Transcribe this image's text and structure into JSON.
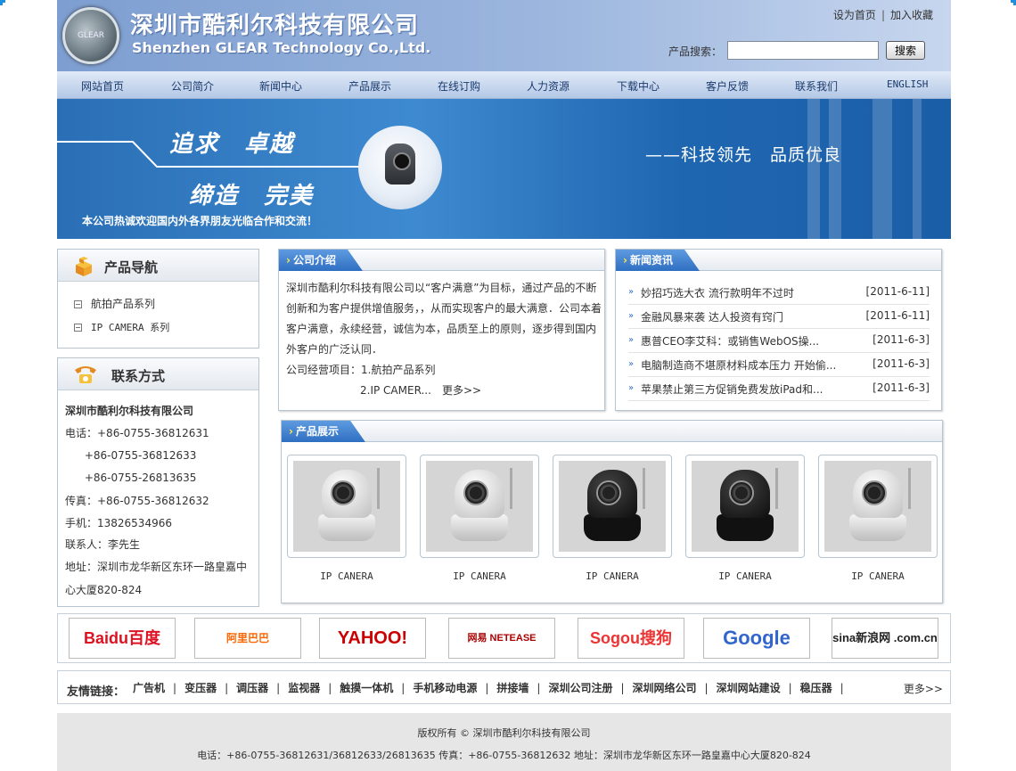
{
  "header": {
    "logo_text": "GLEAR",
    "company_cn": "深圳市酷利尔科技有限公司",
    "company_en": "Shenzhen GLEAR Technology Co.,Ltd.",
    "set_home": "设为首页",
    "separator": "|",
    "add_favorite": "加入收藏",
    "search_label": "产品搜索：",
    "search_value": "",
    "search_button": "搜索"
  },
  "nav": [
    "网站首页",
    "公司简介",
    "新闻中心",
    "产品展示",
    "在线订购",
    "人力资源",
    "下载中心",
    "客户反馈",
    "联系我们",
    "ENGLISH"
  ],
  "banner": {
    "slogan1": "追求　卓越",
    "slogan2": "缔造　完美",
    "slogan3": "——科技领先　品质优良",
    "welcome": "本公司热诚欢迎国内外各界朋友光临合作和交流！"
  },
  "product_nav": {
    "title": "产品导航",
    "items": [
      "航拍产品系列",
      "IP CAMERA 系列"
    ]
  },
  "contact": {
    "title": "联系方式",
    "company": "深圳市酷利尔科技有限公司",
    "lines": [
      "电话：+86-0755-36812631",
      "　 +86-0755-36812633",
      "　 +86-0755-26813635",
      "传真：+86-0755-36812632",
      "手机：13826534966",
      "联系人：李先生",
      "地址：深圳市龙华新区东环一路皇嘉中",
      "心大厦820-824"
    ]
  },
  "about": {
    "title": "公司介绍",
    "text1": "深圳市酷利尔科技有限公司以“客户满意”为目标，通过产品的不断创新和为客户提供增值服务，，从而实现客户的最大满意．公司本着客户满意，永续经营，诚信为本，品质至上的原则，逐步得到国内外客户的广泛认同．",
    "text2": "公司经营项目：1.航拍产品系列",
    "text3": "2.IP CAMER...",
    "more": "更多>>"
  },
  "news": {
    "title": "新闻资讯",
    "items": [
      {
        "title": "妙招巧选大衣 流行款明年不过时",
        "date": "[2011-6-11]"
      },
      {
        "title": "金融风暴来袭 达人投资有窍门",
        "date": "[2011-6-11]"
      },
      {
        "title": "惠普CEO李艾科：或销售WebOS操...",
        "date": "[2011-6-3]"
      },
      {
        "title": "电脑制造商不堪原材料成本压力 开始偷...",
        "date": "[2011-6-3]"
      },
      {
        "title": "苹果禁止第三方促销免费发放iPad和...",
        "date": "[2011-6-3]"
      }
    ]
  },
  "products": {
    "title": "产品展示",
    "items": [
      {
        "label": "IP CANERA",
        "color": "#e8e8e8"
      },
      {
        "label": "IP CANERA",
        "color": "#e8e8e8"
      },
      {
        "label": "IP CANERA",
        "color": "#1a1a1a"
      },
      {
        "label": "IP CANERA",
        "color": "#1a1a1a"
      },
      {
        "label": "IP CANERA",
        "color": "#cfcfcf"
      }
    ]
  },
  "partner_logos": [
    "Baidu百度",
    "阿里巴巴 Alibaba.com.cn",
    "YAHOO!",
    "网易 NETEASE www.163.com",
    "Sogou搜狗",
    "Google",
    "sina新浪网 .com.cn"
  ],
  "links": {
    "label": "友情链接：",
    "items": [
      "广告机",
      "变压器",
      "调压器",
      "监视器",
      "触摸一体机",
      "手机移动电源",
      "拼接墙",
      "深圳公司注册",
      "深圳网络公司",
      "深圳网站建设",
      "稳压器"
    ],
    "separator": "|",
    "more": "更多>>"
  },
  "footer": {
    "copyright": "版权所有 © 深圳市酷利尔科技有限公司",
    "contact": "电话：+86-0755-36812631/36812633/26813635 传真：+86-0755-36812632 地址：深圳市龙华新区东环一路皇嘉中心大厦820-824"
  },
  "colors": {
    "nav_text": "#1a3a6e",
    "tab_blue": "#2f6fc2",
    "banner_blue": "#2a6fb6"
  }
}
